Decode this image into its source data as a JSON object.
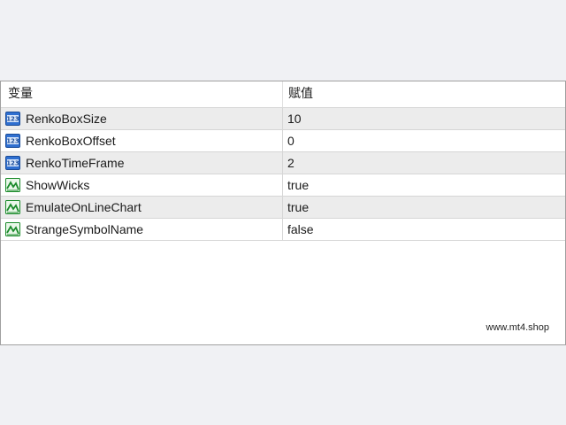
{
  "header": {
    "col_name": "变量",
    "col_value": "赋值"
  },
  "rows": [
    {
      "name": "RenkoBoxSize",
      "value": "10",
      "icon": "numeric-123-icon"
    },
    {
      "name": "RenkoBoxOffset",
      "value": "0",
      "icon": "numeric-123-icon"
    },
    {
      "name": "RenkoTimeFrame",
      "value": "2",
      "icon": "numeric-123-icon"
    },
    {
      "name": "ShowWicks",
      "value": "true",
      "icon": "boolean-chart-icon"
    },
    {
      "name": "EmulateOnLineChart",
      "value": "true",
      "icon": "boolean-chart-icon"
    },
    {
      "name": "StrangeSymbolName",
      "value": "false",
      "icon": "boolean-chart-icon"
    }
  ],
  "watermark": "www.mt4.shop",
  "colors": {
    "numeric_icon_bg": "#2f6fd0",
    "boolean_icon_line": "#1a8a2a",
    "alt_row_bg": "#ececec",
    "outer_bg": "#f0f1f4"
  }
}
